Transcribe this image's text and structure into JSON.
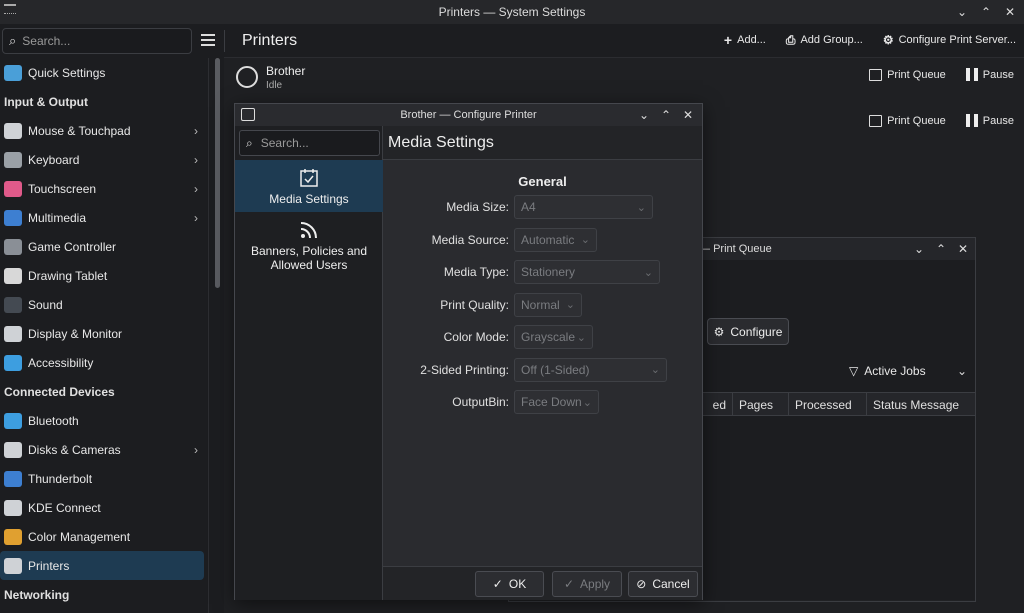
{
  "window": {
    "title": "Printers — System Settings"
  },
  "sidebar": {
    "search_placeholder": "Search...",
    "groups": [
      {
        "header": "",
        "items": [
          {
            "label": "Quick Settings",
            "icon": "quick-settings-icon",
            "color": "#4a9fd8",
            "chevron": false
          }
        ]
      },
      {
        "header": "Input & Output",
        "items": [
          {
            "label": "Mouse & Touchpad",
            "icon": "mouse-icon",
            "color": "#cfd2d6",
            "chevron": true
          },
          {
            "label": "Keyboard",
            "icon": "keyboard-icon",
            "color": "#9aa0a6",
            "chevron": true
          },
          {
            "label": "Touchscreen",
            "icon": "touchscreen-icon",
            "color": "#e05a8a",
            "chevron": true
          },
          {
            "label": "Multimedia",
            "icon": "multimedia-icon",
            "color": "#3d7fd1",
            "chevron": true
          },
          {
            "label": "Game Controller",
            "icon": "gamepad-icon",
            "color": "#8a8f96",
            "chevron": false
          },
          {
            "label": "Drawing Tablet",
            "icon": "tablet-icon",
            "color": "#d8d8d8",
            "chevron": false
          },
          {
            "label": "Sound",
            "icon": "sound-icon",
            "color": "#444a52",
            "chevron": false
          },
          {
            "label": "Display & Monitor",
            "icon": "display-icon",
            "color": "#cfd2d6",
            "chevron": false
          },
          {
            "label": "Accessibility",
            "icon": "accessibility-icon",
            "color": "#3d9ee0",
            "chevron": false
          }
        ]
      },
      {
        "header": "Connected Devices",
        "items": [
          {
            "label": "Bluetooth",
            "icon": "bluetooth-icon",
            "color": "#3d9ee0",
            "chevron": false
          },
          {
            "label": "Disks & Cameras",
            "icon": "disks-icon",
            "color": "#cfd2d6",
            "chevron": true
          },
          {
            "label": "Thunderbolt",
            "icon": "thunderbolt-icon",
            "color": "#3d7fd1",
            "chevron": false
          },
          {
            "label": "KDE Connect",
            "icon": "kde-connect-icon",
            "color": "#cfd2d6",
            "chevron": false
          },
          {
            "label": "Color Management",
            "icon": "color-management-icon",
            "color": "#e0a030",
            "chevron": false
          },
          {
            "label": "Printers",
            "icon": "printer-icon",
            "color": "#cfd2d6",
            "chevron": false,
            "active": true
          }
        ]
      },
      {
        "header": "Networking",
        "items": []
      }
    ]
  },
  "header": {
    "page_title": "Printers",
    "actions": [
      {
        "label": "Add...",
        "icon": "plus-icon"
      },
      {
        "label": "Add Group...",
        "icon": "printer-icon"
      },
      {
        "label": "Configure Print Server...",
        "icon": "sliders-icon"
      }
    ]
  },
  "printers": [
    {
      "name": "Brother",
      "status": "Idle",
      "queue_label": "Print Queue",
      "pause_label": "Pause"
    },
    {
      "name": "",
      "status": "",
      "queue_label": "Print Queue",
      "pause_label": "Pause"
    }
  ],
  "print_queue": {
    "title": "ther — Print Queue",
    "configure_label": "Configure",
    "filter_label": "Active Jobs",
    "columns": [
      "ed",
      "Pages",
      "Processed",
      "Status Message"
    ]
  },
  "dialog": {
    "title": "Brother — Configure Printer",
    "search_placeholder": "Search...",
    "categories": [
      {
        "label": "Media Settings",
        "icon": "media-settings-icon",
        "active": true
      },
      {
        "label": "Banners, Policies and Allowed Users",
        "icon": "rss-icon",
        "active": false
      }
    ],
    "page_header": "Media Settings",
    "section": "General",
    "fields": [
      {
        "label": "Media Size:",
        "value": "A4"
      },
      {
        "label": "Media Source:",
        "value": "Automatic"
      },
      {
        "label": "Media Type:",
        "value": "Stationery"
      },
      {
        "label": "Print Quality:",
        "value": "Normal"
      },
      {
        "label": "Color Mode:",
        "value": "Grayscale"
      },
      {
        "label": "2-Sided Printing:",
        "value": "Off (1-Sided)"
      },
      {
        "label": "OutputBin:",
        "value": "Face Down"
      }
    ],
    "buttons": {
      "ok": "OK",
      "apply": "Apply",
      "cancel": "Cancel"
    }
  }
}
